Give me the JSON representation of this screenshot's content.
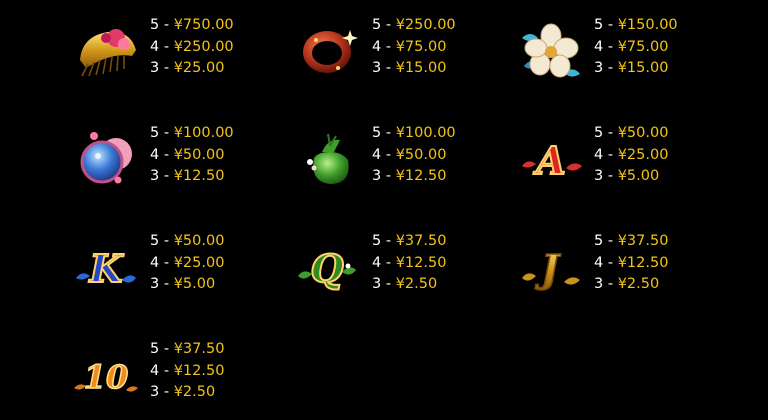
{
  "colors": {
    "background": "#000000",
    "count_text": "#ffffff",
    "amount_text": "#f2c318"
  },
  "paytable": [
    {
      "symbol": "comb-icon",
      "pays": [
        {
          "count": "5",
          "amount": "¥750.00"
        },
        {
          "count": "4",
          "amount": "¥250.00"
        },
        {
          "count": "3",
          "amount": "¥25.00"
        }
      ]
    },
    {
      "symbol": "ring-icon",
      "pays": [
        {
          "count": "5",
          "amount": "¥250.00"
        },
        {
          "count": "4",
          "amount": "¥75.00"
        },
        {
          "count": "3",
          "amount": "¥15.00"
        }
      ]
    },
    {
      "symbol": "flower-icon",
      "pays": [
        {
          "count": "5",
          "amount": "¥150.00"
        },
        {
          "count": "4",
          "amount": "¥75.00"
        },
        {
          "count": "3",
          "amount": "¥15.00"
        }
      ]
    },
    {
      "symbol": "mirror-icon",
      "pays": [
        {
          "count": "5",
          "amount": "¥100.00"
        },
        {
          "count": "4",
          "amount": "¥50.00"
        },
        {
          "count": "3",
          "amount": "¥12.50"
        }
      ]
    },
    {
      "symbol": "pouch-icon",
      "pays": [
        {
          "count": "5",
          "amount": "¥100.00"
        },
        {
          "count": "4",
          "amount": "¥50.00"
        },
        {
          "count": "3",
          "amount": "¥12.50"
        }
      ]
    },
    {
      "symbol": "letter-a-icon",
      "glyph": "A",
      "pays": [
        {
          "count": "5",
          "amount": "¥50.00"
        },
        {
          "count": "4",
          "amount": "¥25.00"
        },
        {
          "count": "3",
          "amount": "¥5.00"
        }
      ]
    },
    {
      "symbol": "letter-k-icon",
      "glyph": "K",
      "pays": [
        {
          "count": "5",
          "amount": "¥50.00"
        },
        {
          "count": "4",
          "amount": "¥25.00"
        },
        {
          "count": "3",
          "amount": "¥5.00"
        }
      ]
    },
    {
      "symbol": "letter-q-icon",
      "glyph": "Q",
      "pays": [
        {
          "count": "5",
          "amount": "¥37.50"
        },
        {
          "count": "4",
          "amount": "¥12.50"
        },
        {
          "count": "3",
          "amount": "¥2.50"
        }
      ]
    },
    {
      "symbol": "letter-j-icon",
      "glyph": "J",
      "pays": [
        {
          "count": "5",
          "amount": "¥37.50"
        },
        {
          "count": "4",
          "amount": "¥12.50"
        },
        {
          "count": "3",
          "amount": "¥2.50"
        }
      ]
    },
    {
      "symbol": "number-10-icon",
      "glyph": "10",
      "pays": [
        {
          "count": "5",
          "amount": "¥37.50"
        },
        {
          "count": "4",
          "amount": "¥12.50"
        },
        {
          "count": "3",
          "amount": "¥2.50"
        }
      ]
    }
  ],
  "separator": "-"
}
